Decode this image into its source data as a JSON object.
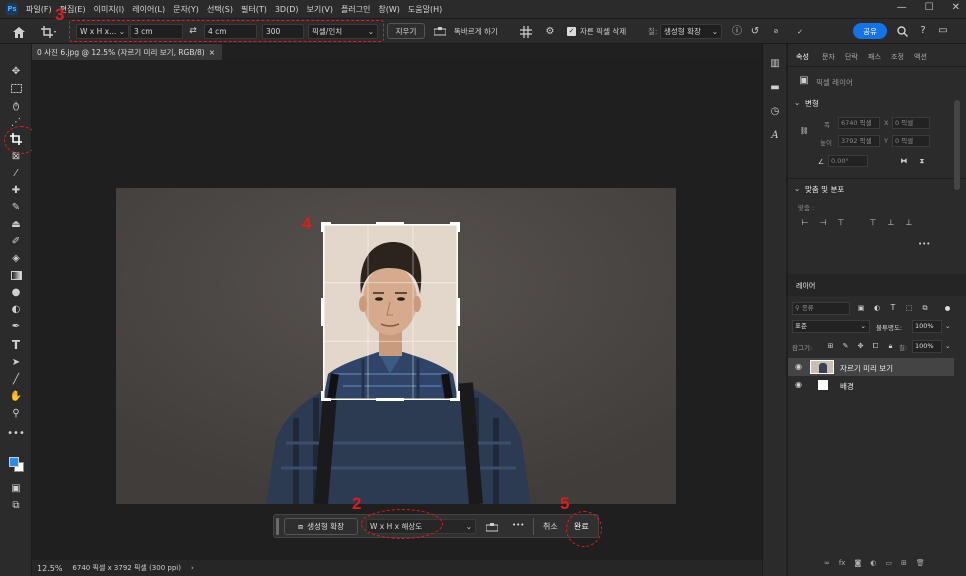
{
  "menubar": {
    "logo": "Ps",
    "items": [
      "파일(F)",
      "편집(E)",
      "이미지(I)",
      "레이어(L)",
      "문자(Y)",
      "선택(S)",
      "필터(T)",
      "3D(D)",
      "보기(V)",
      "플러그인",
      "창(W)",
      "도움말(H)"
    ],
    "window_controls": [
      "—",
      "☐",
      "✕"
    ]
  },
  "optbar": {
    "ratio_select": "W x H x...",
    "width_value": "3 cm",
    "swap_icon": "⇄",
    "height_value": "4 cm",
    "resolution_value": "300",
    "resolution_unit": "픽셀/인치",
    "clear_button": "지우기",
    "straighten_label": "똑바르게 하기",
    "delete_cropped_checked": true,
    "delete_cropped_label": "자른 픽셀 삭제",
    "fill_label": "칠:",
    "fill_value": "생성형 확장",
    "share_button": "공유"
  },
  "annotations": {
    "n1": "1",
    "n2": "2",
    "n3": "3",
    "n4": "4",
    "n5": "5"
  },
  "doc": {
    "tab_title": "0 사진 6.jpg @ 12.5% (자르기 미리 보기, RGB/8)",
    "tab_close": "×",
    "zoom": "12.5%",
    "size_info": "6740 픽셀 x 3792 픽셀 (300 ppi)",
    "status_arrow": "›"
  },
  "contextbar": {
    "gen_expand_button": "생성형 확장",
    "ratio_select": "W x H x 해상도",
    "more": "•••",
    "cancel": "취소",
    "done": "완료"
  },
  "properties": {
    "tabs": [
      "속성",
      "문자",
      "단락",
      "패스",
      "조정",
      "액션"
    ],
    "layer_type": "픽셀 레이어",
    "transform_title": "변형",
    "w_label": "폭",
    "w_value": "6740 픽셀",
    "x_label": "X",
    "x_value": "0 픽셀",
    "h_label": "높이",
    "h_value": "3792 픽셀",
    "y_label": "Y",
    "y_value": "0 픽셀",
    "angle_value": "0.00°",
    "align_title": "맞춤 및 분포",
    "align_label": "맞춤 :",
    "more": "•••"
  },
  "layers": {
    "title": "레이어",
    "filter_label": "종류",
    "blend_mode": "표준",
    "opacity_label": "불투명도:",
    "opacity_value": "100%",
    "lock_label": "잠그기:",
    "fill_label": "칠:",
    "fill_value": "100%",
    "items": [
      {
        "name": "자르기 미리 보기"
      },
      {
        "name": "배경"
      }
    ]
  },
  "colors": {
    "accent": "#1473e6",
    "annotation": "#e21b1b",
    "fg_color": "#2b8de8",
    "bg_color": "#ffffff"
  }
}
